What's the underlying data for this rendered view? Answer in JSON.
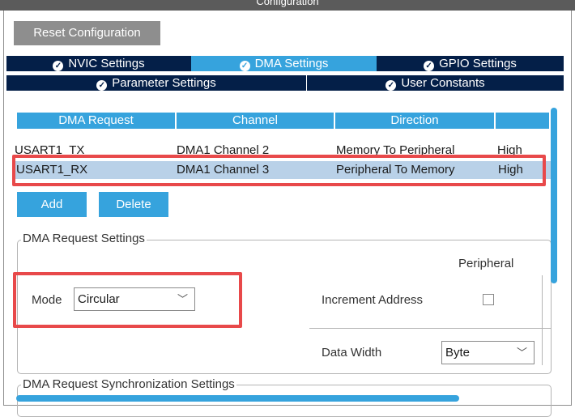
{
  "window": {
    "title": "Configuration"
  },
  "toolbar": {
    "reset_label": "Reset Configuration"
  },
  "tabs": {
    "row1": [
      {
        "label": "NVIC Settings",
        "active": false
      },
      {
        "label": "DMA Settings",
        "active": true
      },
      {
        "label": "GPIO Settings",
        "active": false
      }
    ],
    "row2": [
      {
        "label": "Parameter Settings",
        "active": false
      },
      {
        "label": "User Constants",
        "active": false
      }
    ]
  },
  "dma_table": {
    "columns": [
      "DMA Request",
      "Channel",
      "Direction",
      ""
    ],
    "rows": [
      {
        "request": "USART1_TX",
        "channel": "DMA1 Channel 2",
        "direction": "Memory To Peripheral",
        "priority": "High",
        "selected": false
      },
      {
        "request": "USART1_RX",
        "channel": "DMA1 Channel 3",
        "direction": "Peripheral To Memory",
        "priority": "High",
        "selected": true
      }
    ]
  },
  "buttons": {
    "add": "Add",
    "delete": "Delete"
  },
  "request_settings": {
    "legend": "DMA Request Settings",
    "peripheral_header": "Peripheral",
    "mode_label": "Mode",
    "mode_value": "Circular",
    "increment_label": "Increment Address",
    "increment_checked": false,
    "data_width_label": "Data Width",
    "data_width_value": "Byte"
  },
  "sync_settings": {
    "legend": "DMA Request Synchronization Settings"
  },
  "colors": {
    "accent": "#36a3dd",
    "tab_dark": "#041f48",
    "highlight": "#e8494a",
    "row_selected": "#b9d1e8",
    "button_gray": "#8e8e8e"
  }
}
